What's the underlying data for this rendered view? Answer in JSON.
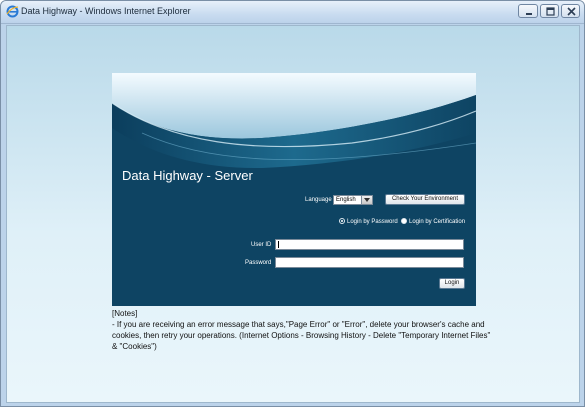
{
  "window": {
    "title": "Data Highway - Windows Internet Explorer"
  },
  "login": {
    "heading": "Data Highway - Server",
    "language_label": "Language",
    "language_value": "English",
    "check_env_label": "Check Your Environment",
    "radio_password_label": "Login by Password",
    "radio_cert_label": "Login by Certification",
    "userid_label": "User ID",
    "password_label": "Password",
    "userid_value": "",
    "password_value": "",
    "login_button_label": "Login"
  },
  "notes": {
    "heading": "[Notes]",
    "line1": "- If you are receiving an error message that says,\"Page Error\" or \"Error\", delete your browser's cache and cookies, then retry your operations. (Internet Options - Browsing History - Delete \"Temporary Internet Files\" & \"Cookies\")"
  },
  "colors": {
    "panel_bg": "#0e4463",
    "window_bg": "#bcd3ea"
  },
  "icons": {
    "browser": "ie-icon",
    "minimize": "minimize-icon",
    "maximize": "maximize-icon",
    "close": "close-icon",
    "dropdown": "chevron-down-icon"
  }
}
